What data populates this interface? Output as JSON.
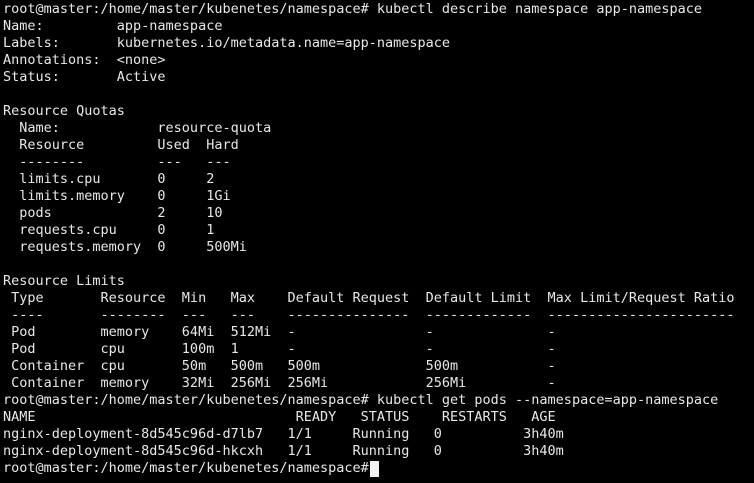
{
  "colors": {
    "background": "#000000",
    "foreground": "#e8e8e8",
    "cursor": "#f2f2f2"
  },
  "terminal": {
    "lines": [
      "root@master:/home/master/kubenetes/namespace# kubectl describe namespace app-namespace",
      "Name:         app-namespace",
      "Labels:       kubernetes.io/metadata.name=app-namespace",
      "Annotations:  <none>",
      "Status:       Active",
      "",
      "Resource Quotas",
      "  Name:            resource-quota",
      "  Resource         Used  Hard",
      "  --------         ---   ---",
      "  limits.cpu       0     2",
      "  limits.memory    0     1Gi",
      "  pods             2     10",
      "  requests.cpu     0     1",
      "  requests.memory  0     500Mi",
      "",
      "Resource Limits",
      " Type       Resource  Min   Max    Default Request  Default Limit  Max Limit/Request Ratio",
      " ----       --------  ---   ---    ---------------  -------------  -----------------------",
      " Pod        memory    64Mi  512Mi  -                -              -",
      " Pod        cpu       100m  1      -                -              -",
      " Container  cpu       50m   500m   500m             500m           -",
      " Container  memory    32Mi  256Mi  256Mi            256Mi          -",
      "root@master:/home/master/kubenetes/namespace# kubectl get pods --namespace=app-namespace",
      "NAME                                READY   STATUS    RESTARTS   AGE",
      "nginx-deployment-8d545c96d-d7lb7   1/1     Running   0          3h40m",
      "nginx-deployment-8d545c96d-hkcxh   1/1     Running   0          3h40m",
      "root@master:/home/master/kubenetes/namespace# "
    ]
  }
}
